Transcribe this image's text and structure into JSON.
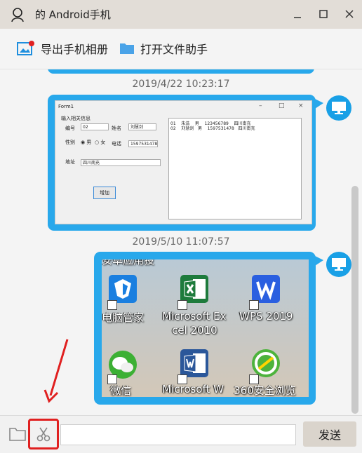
{
  "window": {
    "title": "的 Android手机"
  },
  "toolbar": {
    "export_label": "导出手机相册",
    "open_label": "打开文件助手"
  },
  "messages": [
    {
      "timestamp": "2019/4/22 10:23:17"
    },
    {
      "timestamp": "2019/5/10 11:07:57"
    }
  ],
  "form_screenshot": {
    "window_title": "Form1",
    "group_label": "输入相关信息",
    "id_label": "编号",
    "id_value": "02",
    "name_label": "姓名",
    "name_value": "刘慧剑",
    "gender_label": "性别",
    "male": "男",
    "female": "女",
    "phone_label": "电话",
    "phone_value": "1597531478",
    "address_label": "地址",
    "address_value": "四川南充",
    "add_button": "增加",
    "rows": [
      "01    朱浩    男    123456789    四川南充",
      "02    刘慧剑   男    1597531478   四川南充"
    ]
  },
  "desktop_screenshot": {
    "top_text": "安卓应用投",
    "icons": [
      {
        "label": "电脑管家"
      },
      {
        "label": "Microsoft Ex"
      },
      {
        "label": "cel 2010"
      },
      {
        "label": "WPS 2019"
      },
      {
        "label": "微信"
      },
      {
        "label": "Microsoft W"
      },
      {
        "label": "360安全浏览"
      }
    ]
  },
  "composer": {
    "placeholder": "",
    "send_label": "发送"
  },
  "colors": {
    "accent": "#28a8eb",
    "highlight": "#e02020"
  }
}
